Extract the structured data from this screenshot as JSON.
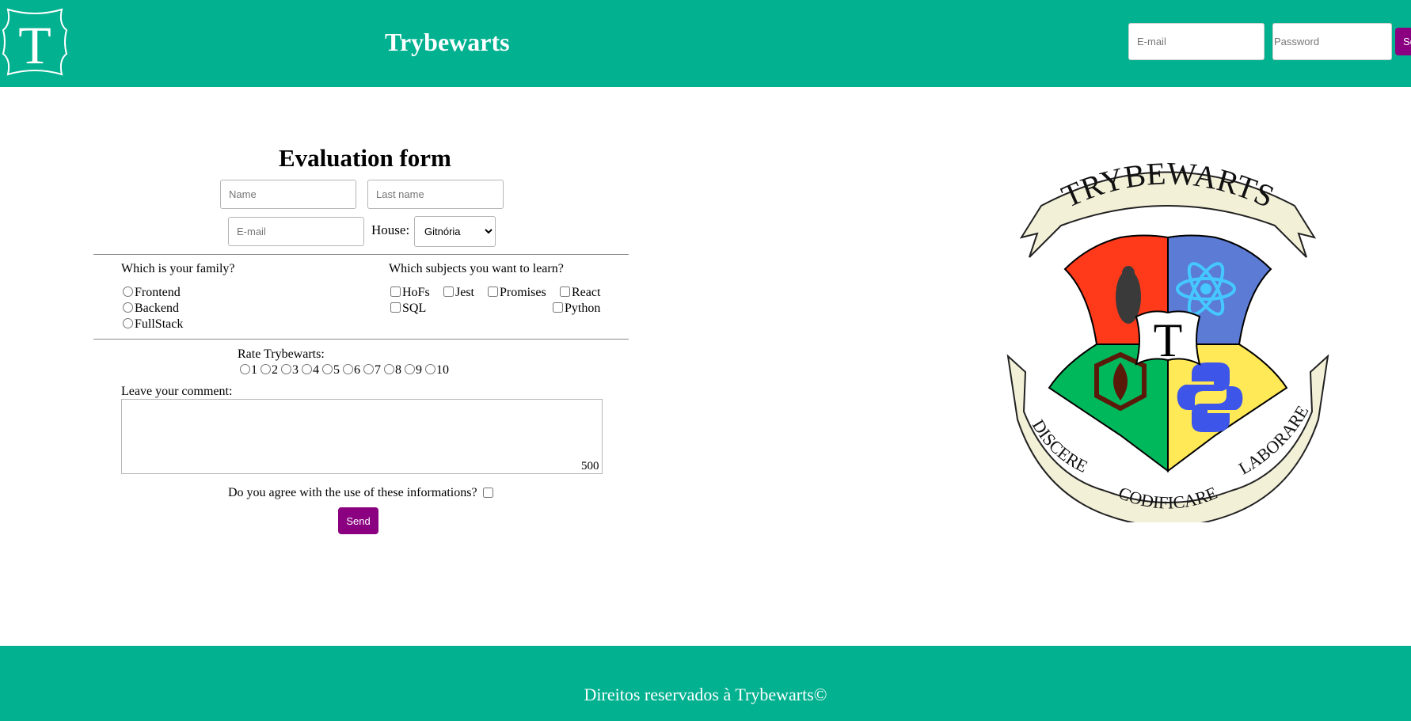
{
  "header": {
    "logo_letter": "T",
    "title": "Trybewarts",
    "email_placeholder": "E-mail",
    "password_placeholder": "Password",
    "submit_label": "Se"
  },
  "form": {
    "title": "Evaluation form",
    "name_placeholder": "Name",
    "lastname_placeholder": "Last name",
    "email_placeholder": "E-mail",
    "house_label": "House:",
    "house_selected": "Gitnória",
    "family_title": "Which is your family?",
    "family_options": [
      "Frontend",
      "Backend",
      "FullStack"
    ],
    "subjects_title": "Which subjects you want to learn?",
    "subjects": [
      "HoFs",
      "Jest",
      "Promises",
      "React",
      "SQL",
      "Python"
    ],
    "rate_title": "Rate Trybewarts:",
    "rate_options": [
      "1",
      "2",
      "3",
      "4",
      "5",
      "6",
      "7",
      "8",
      "9",
      "10"
    ],
    "comment_label": "Leave your comment:",
    "counter": "500",
    "agree_label": "Do you agree with the use of these informations?",
    "send_label": "Send"
  },
  "crest": {
    "top_banner": "TRYBEWARTS",
    "center_letter": "T",
    "left_banner": "DISCERE",
    "bottom_banner": "CODIFICARE",
    "right_banner": "LABORARE",
    "colors": {
      "red": "#ff3a1a",
      "blue": "#5b7bd5",
      "green": "#00b85c",
      "yellow": "#ffe957",
      "banner": "#f3f0d8"
    }
  },
  "footer": {
    "text": "Direitos reservados à Trybewarts©"
  },
  "colors": {
    "primary": "#02b190",
    "accent": "#8a0080"
  }
}
